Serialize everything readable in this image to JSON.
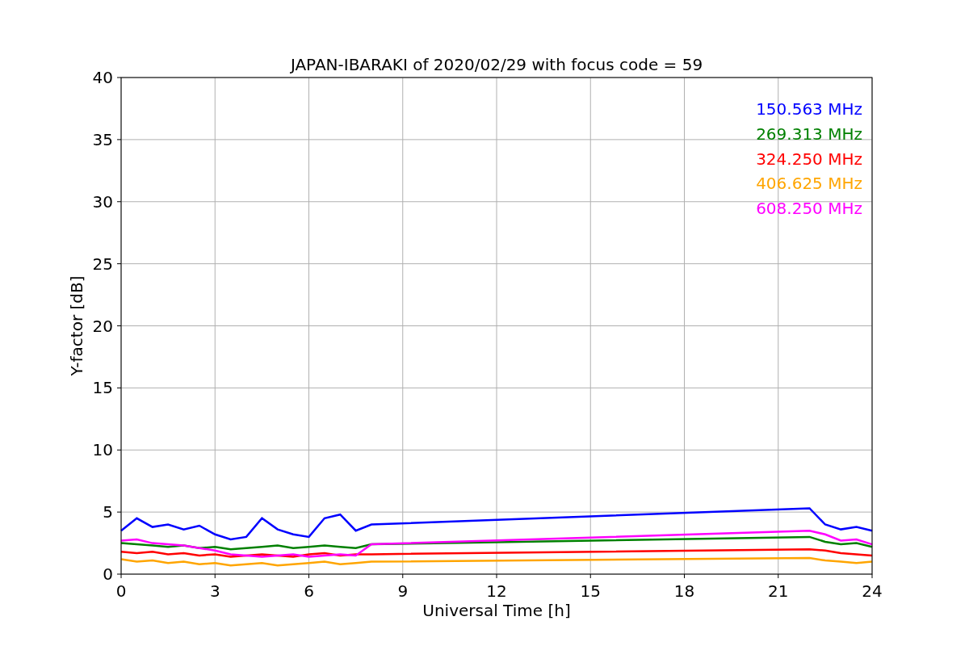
{
  "chart_data": {
    "type": "line",
    "title": "JAPAN-IBARAKI of 2020/02/29 with focus code = 59",
    "xlabel": "Universal Time [h]",
    "ylabel": "Y-factor [dB]",
    "x": [
      0,
      0.5,
      1,
      1.5,
      2,
      2.5,
      3,
      3.5,
      4,
      4.5,
      5,
      5.5,
      6,
      6.5,
      7,
      7.5,
      8,
      22,
      22.5,
      23,
      23.5,
      24
    ],
    "series": [
      {
        "name": "150.563 MHz",
        "color": "#0000ff",
        "values": [
          3.5,
          4.5,
          3.8,
          4.0,
          3.6,
          3.9,
          3.2,
          2.8,
          3.0,
          4.5,
          3.6,
          3.2,
          3.0,
          4.5,
          4.8,
          3.5,
          4.0,
          5.3,
          4.0,
          3.6,
          3.8,
          3.5
        ]
      },
      {
        "name": "269.313 MHz",
        "color": "#008000",
        "values": [
          2.5,
          2.4,
          2.3,
          2.2,
          2.3,
          2.1,
          2.2,
          2.0,
          2.1,
          2.2,
          2.3,
          2.1,
          2.2,
          2.3,
          2.2,
          2.1,
          2.4,
          3.0,
          2.6,
          2.4,
          2.5,
          2.2
        ]
      },
      {
        "name": "324.250 MHz",
        "color": "#ff0000",
        "values": [
          1.8,
          1.7,
          1.8,
          1.6,
          1.7,
          1.5,
          1.6,
          1.4,
          1.5,
          1.6,
          1.5,
          1.4,
          1.6,
          1.7,
          1.5,
          1.6,
          1.6,
          2.0,
          1.9,
          1.7,
          1.6,
          1.5
        ]
      },
      {
        "name": "406.625 MHz",
        "color": "#ffa500",
        "values": [
          1.2,
          1.0,
          1.1,
          0.9,
          1.0,
          0.8,
          0.9,
          0.7,
          0.8,
          0.9,
          0.7,
          0.8,
          0.9,
          1.0,
          0.8,
          0.9,
          1.0,
          1.3,
          1.1,
          1.0,
          0.9,
          1.0
        ]
      },
      {
        "name": "608.250 MHz",
        "color": "#ff00ff",
        "values": [
          2.7,
          2.8,
          2.5,
          2.4,
          2.3,
          2.1,
          1.9,
          1.6,
          1.5,
          1.4,
          1.5,
          1.6,
          1.4,
          1.5,
          1.6,
          1.5,
          2.4,
          3.5,
          3.2,
          2.7,
          2.8,
          2.4
        ]
      }
    ],
    "xlim": [
      0,
      24
    ],
    "ylim": [
      0,
      40
    ],
    "xticks": [
      0,
      3,
      6,
      9,
      12,
      15,
      18,
      21,
      24
    ],
    "yticks": [
      0,
      5,
      10,
      15,
      20,
      25,
      30,
      35,
      40
    ],
    "grid": true
  }
}
